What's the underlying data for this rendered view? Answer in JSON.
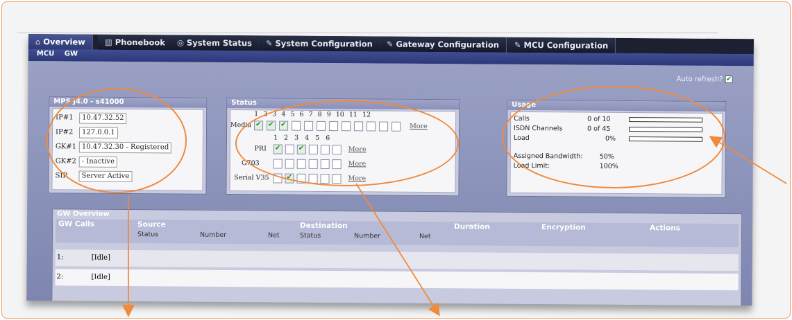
{
  "tabs": [
    {
      "icon": "house-icon",
      "glyph": "⌂",
      "label": "Overview"
    },
    {
      "icon": "phonebook-icon",
      "glyph": "▥",
      "label": "Phonebook"
    },
    {
      "icon": "gauge-icon",
      "glyph": "◎",
      "label": "System Status"
    },
    {
      "icon": "wrench-icon",
      "glyph": "✎",
      "label": "System Configuration"
    },
    {
      "icon": "wrench-icon",
      "glyph": "✎",
      "label": "Gateway Configuration"
    },
    {
      "icon": "wrench-icon",
      "glyph": "✎",
      "label": "MCU Configuration"
    }
  ],
  "subnav": [
    "MCU",
    "GW"
  ],
  "auto_refresh": {
    "label": "Auto refresh?",
    "checked": true
  },
  "mps_panel": {
    "title": "MPS J4.0 - s41000",
    "rows": [
      {
        "label": "IP#1",
        "value": "10.47.32.52"
      },
      {
        "label": "IP#2",
        "value": "127.0.0.1"
      },
      {
        "label": "GK#1",
        "value": "10.47.32.30 - Registered"
      },
      {
        "label": "GK#2",
        "value": "- Inactive"
      },
      {
        "label": "SIP",
        "value": "Server Active"
      }
    ]
  },
  "status_panel": {
    "title": "Status",
    "media_numbers": "1 2 3 4 5 6 7 8 9 10 11 12",
    "port_numbers": "1 2 3 4 5 6",
    "media_label": "Media",
    "more_label": "More",
    "rows": [
      {
        "label": "PRI",
        "checked": [
          1,
          3
        ]
      },
      {
        "label": "G703",
        "checked": []
      },
      {
        "label": "Serial V35",
        "checked": [
          2
        ]
      }
    ],
    "media_checked": [
      1,
      2,
      3
    ]
  },
  "usage_panel": {
    "title": "Usage",
    "rows": [
      {
        "label": "Calls",
        "value": "0 of 10",
        "fill": 0
      },
      {
        "label": "ISDN Channels",
        "value": "0 of 45",
        "fill": 0
      },
      {
        "label": "Load",
        "value": "0%",
        "fill": 0
      }
    ],
    "bandwidth_label": "Assigned Bandwidth:",
    "bandwidth_value": "50%",
    "limit_label": "Load Limit:",
    "limit_value": "100%"
  },
  "gw_overview": {
    "title": "GW Overview",
    "headers": {
      "calls": "GW Calls",
      "source": "Source",
      "destination": "Destination",
      "duration": "Duration",
      "encryption": "Encryption",
      "actions": "Actions"
    },
    "subheaders": [
      "Status",
      "Number",
      "Net",
      "Status",
      "Number",
      "Net"
    ],
    "rows": [
      {
        "index": "1:",
        "status": "[Idle]"
      },
      {
        "index": "2:",
        "status": "[Idle]"
      }
    ]
  },
  "annotation_color": "#f08a3c"
}
